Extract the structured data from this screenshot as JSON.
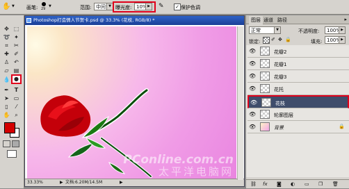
{
  "options": {
    "brush_label": "画笔:",
    "brush_size": "29",
    "range_label": "范围:",
    "range_value": "中间调",
    "exposure_label": "曝光度:",
    "exposure_value": "10%",
    "protect_label": "保护色调"
  },
  "document": {
    "title": "Photoshop打造情人节贺卡.psd @ 33.3% (花枝, RGB/8) *",
    "zoom": "33.33%",
    "doc_size": "文档:6.20M/14.5M",
    "watermark_main": "PConline.com.cn",
    "watermark_sub": "太平洋电脑网"
  },
  "panel": {
    "tabs": [
      "图层",
      "通道",
      "路径"
    ],
    "blend_mode": "正常",
    "opacity_label": "不透明度:",
    "opacity_value": "100%",
    "lock_label": "锁定:",
    "fill_label": "填充:",
    "fill_value": "100%",
    "layers": [
      {
        "name": "花瓣2"
      },
      {
        "name": "花瓣1"
      },
      {
        "name": "花瓣3"
      },
      {
        "name": "花托"
      },
      {
        "name": "花枝"
      },
      {
        "name": "轮廓图层"
      },
      {
        "name": "背景"
      }
    ]
  },
  "colors": {
    "foreground": "#d40000",
    "selected_layer": "#3f4d6b",
    "highlight": "#e0001b"
  }
}
